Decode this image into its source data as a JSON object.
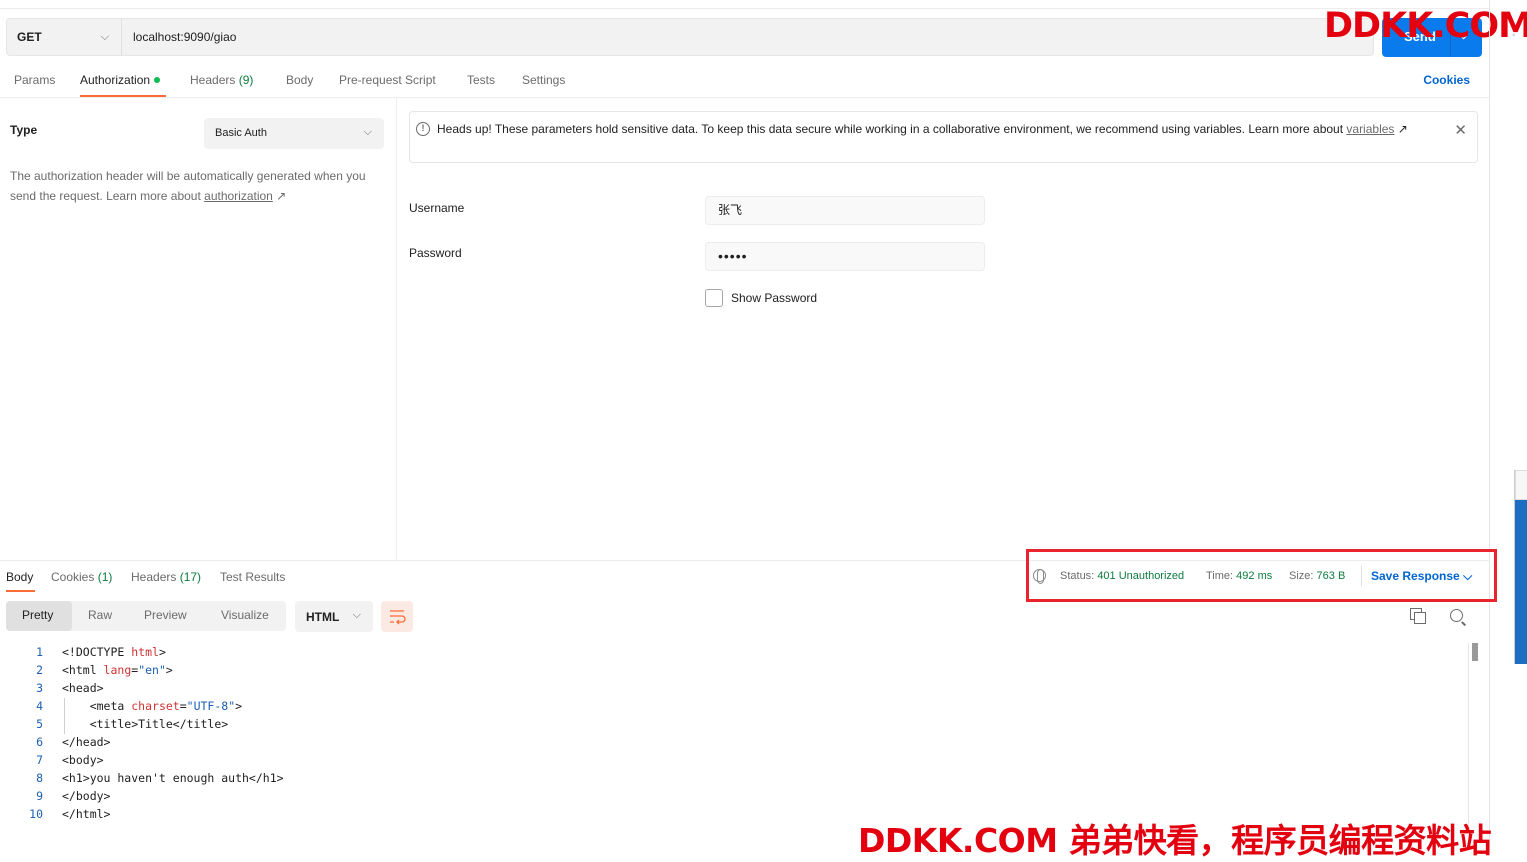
{
  "request": {
    "method": "GET",
    "url": "localhost:9090/giao",
    "send_label": "Send"
  },
  "watermark": {
    "top": "DDKK.COM",
    "bottom": "DDKK.COM 弟弟快看，程序员编程资料站"
  },
  "request_tabs": [
    {
      "label": "Params"
    },
    {
      "label": "Authorization"
    },
    {
      "label": "Headers",
      "count": "(9)"
    },
    {
      "label": "Body"
    },
    {
      "label": "Pre-request Script"
    },
    {
      "label": "Tests"
    },
    {
      "label": "Settings"
    }
  ],
  "cookies_link": "Cookies",
  "auth": {
    "type_label": "Type",
    "type_value": "Basic Auth",
    "desc_prefix": "The authorization header will be automatically generated when you send the request. Learn more about ",
    "desc_link": "authorization",
    "arrow": "↗"
  },
  "notice": {
    "text": "Heads up! These parameters hold sensitive data. To keep this data secure while working in a collaborative environment, we recommend using variables. Learn more about ",
    "link": "variables",
    "close": "✕"
  },
  "fields": {
    "username_label": "Username",
    "username_value": "张飞",
    "password_label": "Password",
    "password_value": "•••••",
    "show_password_label": "Show Password"
  },
  "response_tabs": [
    {
      "label": "Body"
    },
    {
      "label": "Cookies",
      "count": "(1)"
    },
    {
      "label": "Headers",
      "count": "(17)"
    },
    {
      "label": "Test Results"
    }
  ],
  "status": {
    "status_label": "Status:",
    "status_value": "401 Unauthorized",
    "time_label": "Time:",
    "time_value": "492 ms",
    "size_label": "Size:",
    "size_value": "763 B",
    "save_response": "Save Response"
  },
  "format_tabs": [
    "Pretty",
    "Raw",
    "Preview",
    "Visualize"
  ],
  "language": "HTML",
  "code_lines": [
    {
      "n": "1",
      "text": "<!DOCTYPE html>"
    },
    {
      "n": "2",
      "text": "<html lang=\"en\">"
    },
    {
      "n": "3",
      "text": "<head>"
    },
    {
      "n": "4",
      "text": "    <meta charset=\"UTF-8\">"
    },
    {
      "n": "5",
      "text": "    <title>Title</title>"
    },
    {
      "n": "6",
      "text": "</head>"
    },
    {
      "n": "7",
      "text": "<body>"
    },
    {
      "n": "8",
      "text": "<h1>you haven't enough auth</h1>"
    },
    {
      "n": "9",
      "text": "</body>"
    },
    {
      "n": "10",
      "text": "</html>"
    }
  ],
  "colors": {
    "accent": "#ff6c37",
    "send_button": "#097bed",
    "link": "#0265d2",
    "status_green": "#0c7c3e",
    "highlight_box": "#e8242c",
    "watermark": "#e3000f"
  }
}
